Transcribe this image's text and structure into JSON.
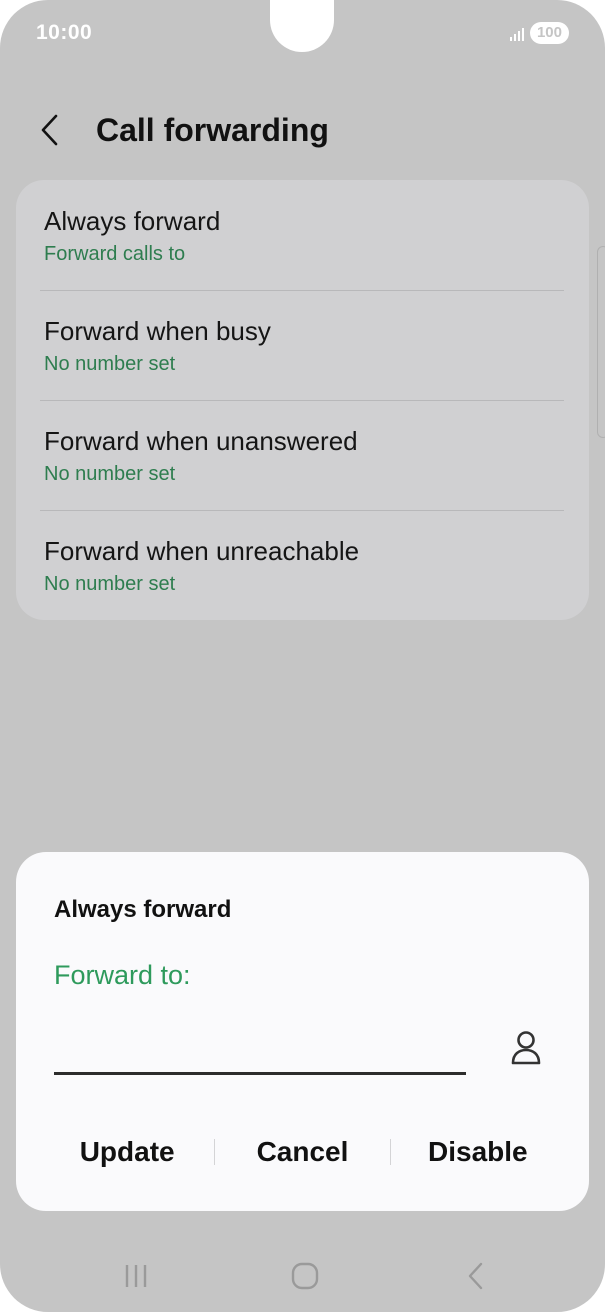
{
  "status_bar": {
    "time": "10:00",
    "battery": "100",
    "signal_icon": "signal-icon"
  },
  "header": {
    "back_icon": "chevron-left-icon",
    "title": "Call forwarding"
  },
  "settings": {
    "items": [
      {
        "title": "Always forward",
        "subtitle": "Forward calls to"
      },
      {
        "title": "Forward when busy",
        "subtitle": "No number set"
      },
      {
        "title": "Forward when unanswered",
        "subtitle": "No number set"
      },
      {
        "title": "Forward when unreachable",
        "subtitle": "No number set"
      }
    ]
  },
  "dialog": {
    "title": "Always forward",
    "label": "Forward to:",
    "input_value": "",
    "contact_icon": "person-icon",
    "buttons": {
      "update": "Update",
      "cancel": "Cancel",
      "disable": "Disable"
    }
  },
  "nav_bar": {
    "recents_icon": "recents-icon",
    "home_icon": "home-icon",
    "back_icon": "back-icon"
  },
  "colors": {
    "background_dim": "#c5c5c5",
    "card": "#d0d0d2",
    "accent_green": "#2e9a5c",
    "subtitle_green": "#2e7d4f",
    "dialog_bg": "#fafafc"
  }
}
